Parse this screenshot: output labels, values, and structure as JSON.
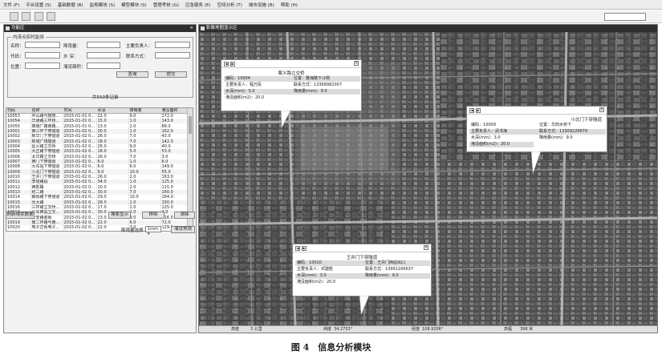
{
  "menu": [
    "文件 (F)",
    "平台设置 (S)",
    "基础数据 (B)",
    "监视模块 (S)",
    "模型模块 (S)",
    "管理考核 (G)",
    "应急服务 (E)",
    "空间分析 (T)",
    "城市设施 (B)",
    "帮助 (H)"
  ],
  "function_panel": {
    "title": "功能区",
    "section_title": "内涝点实时监测",
    "labels": {
      "name": "名称：",
      "code": "代码：",
      "position": "位置：",
      "rainfall": "降雨量：",
      "water_depth": "水 深：",
      "flood_area": "淹没面积：",
      "manager": "主要负责人：",
      "contact": "联系方式："
    },
    "query_button": "查询",
    "submit_button": "提交",
    "record_count": "共550条记录",
    "columns": [
      "代码",
      "名称",
      "时间",
      "水深",
      "降雨量",
      "淹没面积"
    ],
    "rows": [
      [
        "10053",
        "中山路与鼓楼...",
        "2015-01-01 0...",
        "22.0",
        "9.0",
        "172.0"
      ],
      [
        "10054",
        "华通路三环桥...",
        "2015-01-01 0...",
        "15.0",
        "1.0",
        "143.0"
      ],
      [
        "10055",
        "玻璃厂路南路...",
        "2015-01-01 0...",
        "13.0",
        "2.0",
        "89.0"
      ],
      [
        "10001",
        "西三环下穿隧道",
        "2015-01-02 0...",
        "30.0",
        "1.0",
        "162.0"
      ],
      [
        "10002",
        "新华门下穿隧道",
        "2015-01-02 0...",
        "26.0",
        "7.0",
        "43.0"
      ],
      [
        "10003",
        "新城广场隧道",
        "2015-01-02 0...",
        "18.0",
        "7.0",
        "142.0"
      ],
      [
        "10004",
        "星火路立交桥",
        "2015-01-02 0...",
        "26.0",
        "9.0",
        "40.0"
      ],
      [
        "10005",
        "大正路下穿隧道",
        "2015-01-02 0...",
        "18.0",
        "5.0",
        "53.0"
      ],
      [
        "10006",
        "太华路立交桥",
        "2015-01-02 0...",
        "26.0",
        "7.0",
        "3.0"
      ],
      [
        "10007",
        "西门下穿隧道",
        "2015-01-02 0...",
        "6.0",
        "1.0",
        "6.0"
      ],
      [
        "10008",
        "大东站下穿隧道",
        "2015-01-02 0...",
        "6.0",
        "6.0",
        "149.0"
      ],
      [
        "10009",
        "小北门下穿隧道",
        "2015-01-02 0...",
        "9.0",
        "10.0",
        "55.0"
      ],
      [
        "10010",
        "王井门下穿隧道",
        "2015-01-02 0...",
        "26.0",
        "2.0",
        "163.0"
      ],
      [
        "10011",
        "李塔路段",
        "2015-01-02 0...",
        "34.0",
        "1.0",
        "125.0"
      ],
      [
        "10012",
        "西影路",
        "2015-01-02 0...",
        "10.0",
        "2.0",
        "115.0"
      ],
      [
        "10013",
        "纪二路",
        "2015-01-02 0...",
        "30.0",
        "7.0",
        "160.0"
      ],
      [
        "10014",
        "朝阳路下穿通道",
        "2015-01-02 0...",
        "29.0",
        "10.0",
        "164.0"
      ],
      [
        "10015",
        "长大路",
        "2015-01-02 0...",
        "28.0",
        "1.0",
        "150.0"
      ],
      [
        "10016",
        "三环路立交桥...",
        "2015-01-02 0...",
        "17.0",
        "1.0",
        "125.0"
      ],
      [
        "10017",
        "火车西站立交...",
        "2015-01-02 0...",
        "30.0",
        "2.0",
        "4.0"
      ],
      [
        "10018",
        "长安路金街",
        "2015-01-02 0...",
        "13.0",
        "9.0",
        "116.0"
      ],
      [
        "10019",
        "南二环路与南...",
        "2015-01-02 0...",
        "22.0",
        "6.0",
        "72.0"
      ],
      [
        "10020",
        "电子正街电子...",
        "2015-01-02 0...",
        "22.0",
        "7.0",
        "129.0"
      ]
    ],
    "refresh_button": "刷新現状数据",
    "search_display_button": "搜索显示",
    "remove_button": "移除",
    "clear_button": "清除",
    "rainfall_select_label": "降雨量选择：",
    "rainfall_select_value": "1mm",
    "forecast_button": "淹没预测"
  },
  "map_panel": {
    "title": "影像地图显示区",
    "status": {
      "label_scale": "高度",
      "scale_value": "3 公里",
      "lat_label": "纬度",
      "lat_value": "34.2753°",
      "lon_label": "经度",
      "lon_value": "108.9206°",
      "elev_label": "高程",
      "elev_value": "398 米"
    }
  },
  "popups": [
    {
      "title": "案义路立交桥",
      "code_label": "编码：",
      "code": "10004",
      "position_label": "位置：",
      "position": "雅海路下斗侧",
      "manager_label": "主要负责人：",
      "manager": "程万民",
      "contact_label": "联系方式：",
      "contact": "13368982007",
      "depth_label": "水深(mm)：",
      "depth": "5.0",
      "rain_label": "降雨量(mm)：",
      "rain": "9.0",
      "area_label": "淹没面积(m2)：",
      "area": "20.0"
    },
    {
      "title": "小北门下穿隧道",
      "code_label": "编码：",
      "code": "10009",
      "position_label": "位置：",
      "position": "华药水桥下",
      "manager_label": "主要负责人：",
      "manager": "武书海",
      "contact_label": "联系方式：",
      "contact": "13309229679",
      "depth_label": "水深(mm)：",
      "depth": "3.0",
      "rain_label": "降雨量(mm)：",
      "rain": "9.0",
      "area_label": "淹没面积(m2)：",
      "area": "20.0"
    },
    {
      "title": "王井门下穿隧道",
      "code_label": "编码：",
      "code": "10010",
      "position_label": "位置：",
      "position": "王井门西站出口",
      "manager_label": "主要负责人：",
      "manager": "邓建胜",
      "contact_label": "联系方式：",
      "contact": "13991166637",
      "depth_label": "水深(mm)：",
      "depth": "3.0",
      "rain_label": "降雨量(mm)：",
      "rain": "9.0",
      "area_label": "淹没面积(m2)：",
      "area": "20.0"
    }
  ],
  "caption": "图 4　信息分析模块"
}
